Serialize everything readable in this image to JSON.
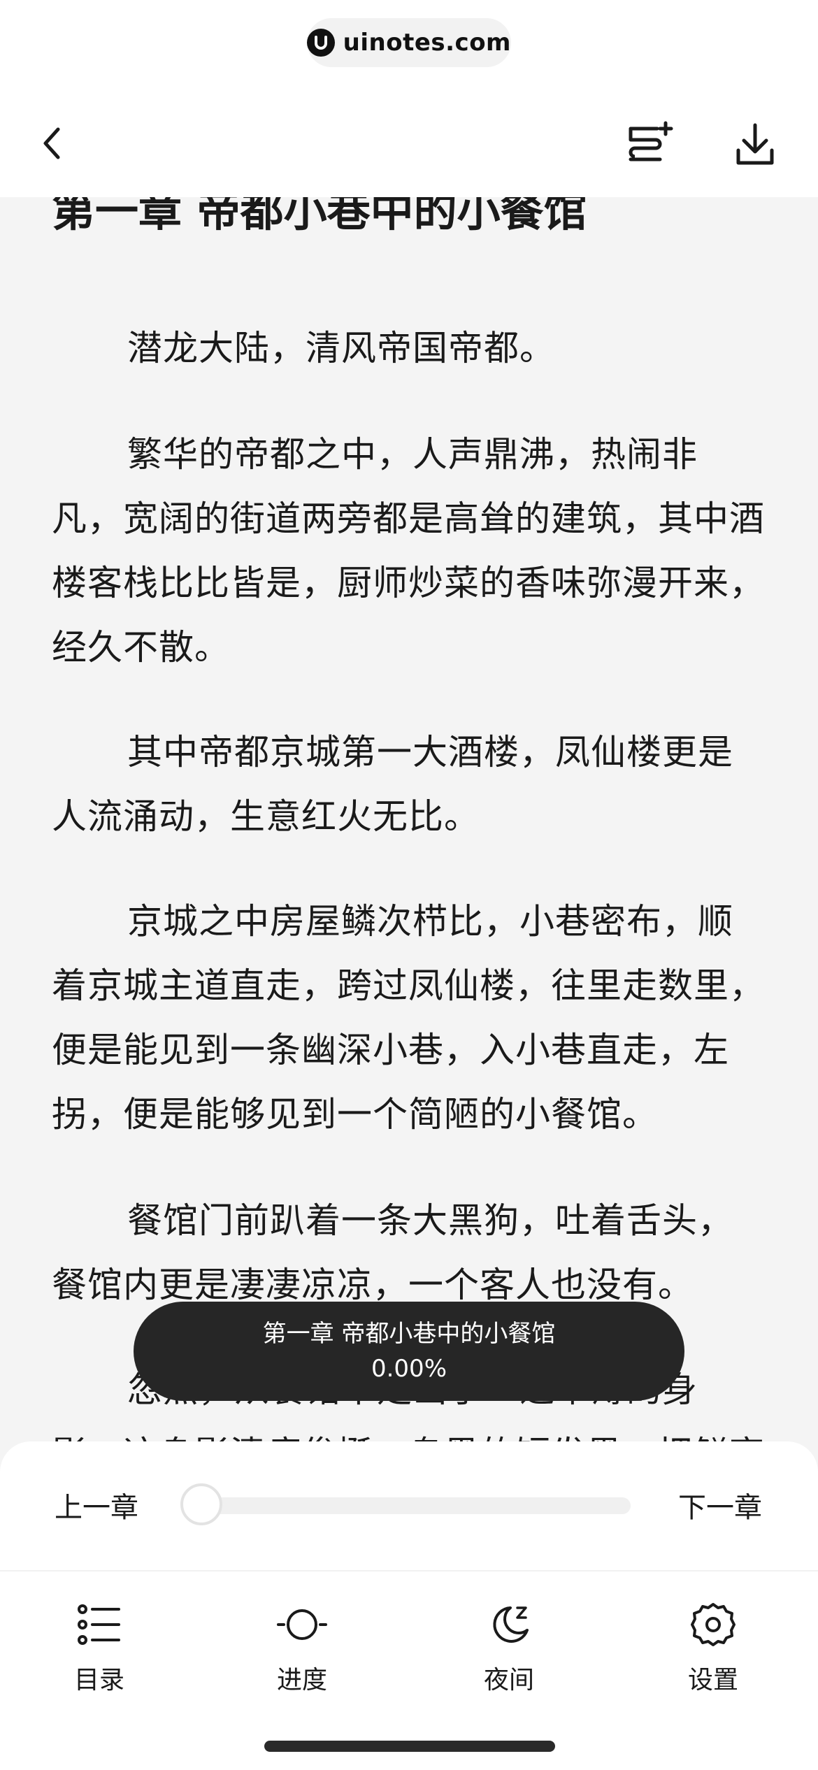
{
  "watermark": {
    "text": "uinotes.com"
  },
  "header": {
    "back_icon": "chevron-left-icon",
    "add_to_shelf_icon": "bookshelf-add-icon",
    "download_icon": "download-icon"
  },
  "chapter": {
    "title": "第一章 帝都小巷中的小餐馆",
    "paragraphs": [
      "潜龙大陆，清风帝国帝都。",
      "繁华的帝都之中，人声鼎沸，热闹非凡，宽阔的街道两旁都是高耸的建筑，其中酒楼客栈比比皆是，厨师炒菜的香味弥漫开来，经久不散。",
      "其中帝都京城第一大酒楼，凤仙楼更是人流涌动，生意红火无比。",
      "京城之中房屋鳞次栉比，小巷密布，顺着京城主道直走，跨过凤仙楼，往里走数里，便是能见到一条幽深小巷，入小巷直走，左拐，便是能够见到一个简陋的小餐馆。",
      "餐馆门前趴着一条大黑狗，吐着舌头，餐馆内更是凄凄凉凉，一个客人也没有。",
      "忽然，从餐馆中走出了一道单薄的身影，这身影清瘦俊挺，乌黑的短发黑，把鲜亮城"
    ]
  },
  "toast": {
    "chapter_title": "第一章 帝都小巷中的小餐馆",
    "progress_text": "0.00%"
  },
  "progress_panel": {
    "prev_chapter_label": "上一章",
    "next_chapter_label": "下一章",
    "progress": 0.0
  },
  "tabs": [
    {
      "label": "目录",
      "icon": "list-icon"
    },
    {
      "label": "进度",
      "icon": "progress-circle-icon"
    },
    {
      "label": "夜间",
      "icon": "moon-icon"
    },
    {
      "label": "设置",
      "icon": "gear-icon"
    }
  ],
  "colors": {
    "background": "#f4f4f4",
    "text": "#1a1a1a",
    "toast_bg": "#262626",
    "panel_bg": "#ffffff"
  }
}
